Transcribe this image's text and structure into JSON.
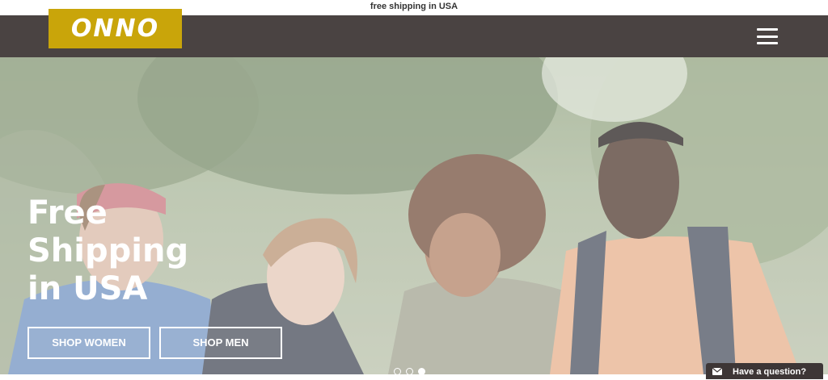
{
  "announcement": {
    "text": "free shipping in USA"
  },
  "brand": {
    "logo_text": "ONNO",
    "logo_color": "#c9a50a",
    "nav_color": "#4a4342"
  },
  "nav": {
    "menu_icon": "hamburger-menu-icon"
  },
  "hero": {
    "headline_lines": [
      "Free",
      "Shipping",
      "in USA"
    ],
    "buttons": [
      {
        "label": "SHOP WOMEN"
      },
      {
        "label": "SHOP MEN"
      }
    ],
    "slides_total": 3,
    "active_slide": 3
  },
  "chat": {
    "label": "Have a question?",
    "icon": "envelope-icon"
  }
}
